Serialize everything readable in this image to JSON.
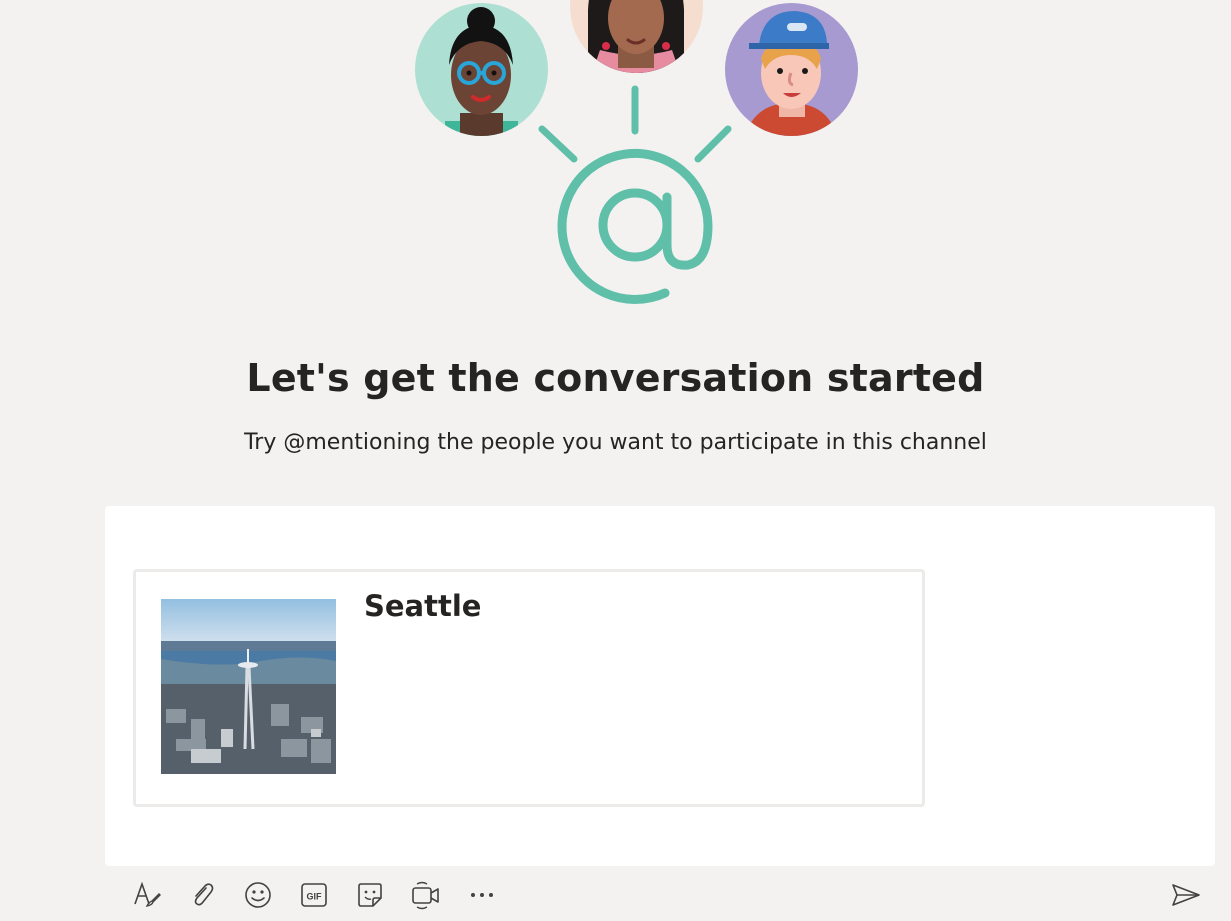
{
  "empty_state": {
    "title": "Let's get the conversation started",
    "subtitle": "Try @mentioning the people you want to participate in this channel",
    "illustration": {
      "icons": [
        "person-avatar-icon",
        "person-avatar-icon",
        "person-avatar-icon",
        "at-sign-icon"
      ],
      "accent_color": "#5fbfa9"
    }
  },
  "compose": {
    "card": {
      "title": "Seattle",
      "thumbnail_icon": "city-photo-icon"
    }
  },
  "toolbar": {
    "icons": [
      "format-icon",
      "attach-icon",
      "emoji-icon",
      "gif-icon",
      "sticker-icon",
      "meet-now-icon",
      "more-options-icon",
      "send-icon"
    ]
  }
}
